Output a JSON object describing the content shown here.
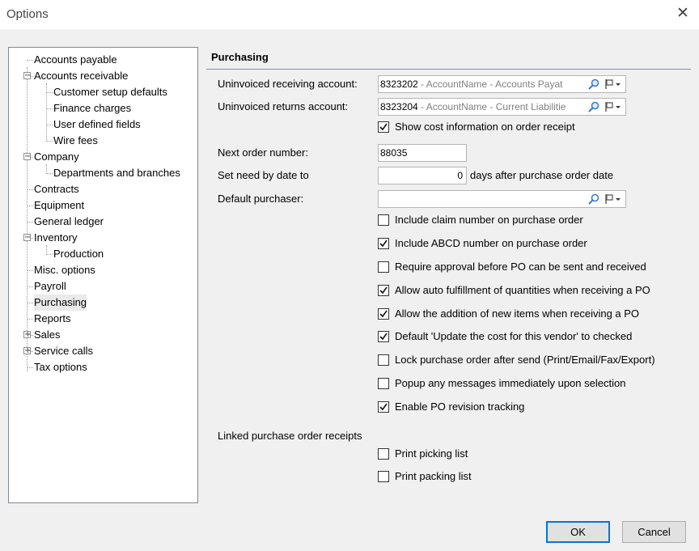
{
  "window": {
    "title": "Options",
    "close_glyph": "✕"
  },
  "tree": {
    "items": [
      {
        "label": "Accounts payable"
      },
      {
        "label": "Accounts receivable",
        "expander": "−"
      },
      {
        "label": "Customer setup defaults"
      },
      {
        "label": "Finance charges"
      },
      {
        "label": "User defined fields"
      },
      {
        "label": "Wire fees"
      },
      {
        "label": "Company",
        "expander": "−"
      },
      {
        "label": "Departments and branches"
      },
      {
        "label": "Contracts"
      },
      {
        "label": "Equipment"
      },
      {
        "label": "General ledger"
      },
      {
        "label": "Inventory",
        "expander": "−"
      },
      {
        "label": "Production"
      },
      {
        "label": "Misc. options"
      },
      {
        "label": "Payroll"
      },
      {
        "label": "Purchasing",
        "selected": true
      },
      {
        "label": "Reports"
      },
      {
        "label": "Sales",
        "expander": "+"
      },
      {
        "label": "Service calls",
        "expander": "+"
      },
      {
        "label": "Tax options"
      }
    ]
  },
  "panel": {
    "title": "Purchasing",
    "uninvoiced_receiving": {
      "label": "Uninvoiced receiving account:",
      "number": "8323202",
      "rest": " - AccountName - Accounts Payat"
    },
    "uninvoiced_returns": {
      "label": "Uninvoiced returns account:",
      "number": "8323204",
      "rest": " - AccountName - Current Liabilitie"
    },
    "show_cost": {
      "label": "Show cost information on order receipt",
      "checked": true
    },
    "next_order": {
      "label": "Next order number:",
      "value": "88035"
    },
    "need_by": {
      "label": "Set need by date to",
      "value": "0",
      "suffix": "days after purchase order date"
    },
    "purchaser": {
      "label": "Default purchaser:",
      "value": ""
    },
    "options": [
      {
        "label": "Include claim number on purchase order",
        "checked": false
      },
      {
        "label": "Include ABCD number on purchase order",
        "checked": true
      },
      {
        "label": "Require approval before PO can be sent and received",
        "checked": false
      },
      {
        "label": "Allow auto fulfillment of quantities when receiving a PO",
        "checked": true
      },
      {
        "label": "Allow the addition of new items when receiving a PO",
        "checked": true
      },
      {
        "label": "Default 'Update the cost for this vendor' to checked",
        "checked": true
      },
      {
        "label": "Lock purchase order after send (Print/Email/Fax/Export)",
        "checked": false
      },
      {
        "label": "Popup any messages immediately upon selection",
        "checked": false
      },
      {
        "label": "Enable PO revision tracking",
        "checked": true
      }
    ],
    "linked": {
      "label": "Linked purchase order receipts",
      "options": [
        {
          "label": "Print picking list",
          "checked": false
        },
        {
          "label": "Print packing list",
          "checked": false
        }
      ]
    }
  },
  "buttons": {
    "ok": "OK",
    "cancel": "Cancel"
  },
  "colors": {
    "accent": "#0078d7",
    "panel_rule": "#6d94bf",
    "icon_blue": "#3a78c8"
  }
}
